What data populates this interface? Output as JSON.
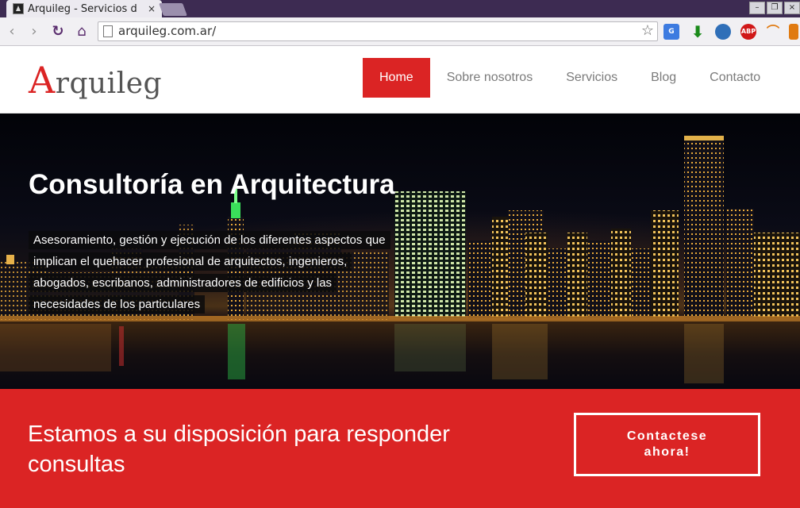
{
  "browser": {
    "tab_title": "Arquileg - Servicios d",
    "tab_close": "×",
    "url": "arquileg.com.ar/",
    "back": "‹",
    "forward": "›",
    "reload": "↻",
    "home": "⌂",
    "star": "☆",
    "win_min": "–",
    "win_max": "❐",
    "win_close": "×",
    "ext_abp": "ABP"
  },
  "site": {
    "logo_first": "A",
    "logo_rest": "rquileg",
    "nav": [
      {
        "label": "Home",
        "active": true
      },
      {
        "label": "Sobre nosotros"
      },
      {
        "label": "Servicios"
      },
      {
        "label": "Blog"
      },
      {
        "label": "Contacto"
      }
    ]
  },
  "hero": {
    "title": "Consultoría en Arquitectura",
    "text": "Asesoramiento, gestión y ejecución de los diferentes aspectos que implican el quehacer profesional de arquitectos, ingenieros, abogados, escribanos, administradores de edificios y las necesidades de los particulares"
  },
  "cta": {
    "text": "Estamos a su disposición para responder consultas",
    "button": "Contactese ahora!"
  },
  "colors": {
    "brand_red": "#db2424",
    "titlebar": "#3d2b52",
    "nav_text": "#7b7b7b"
  }
}
